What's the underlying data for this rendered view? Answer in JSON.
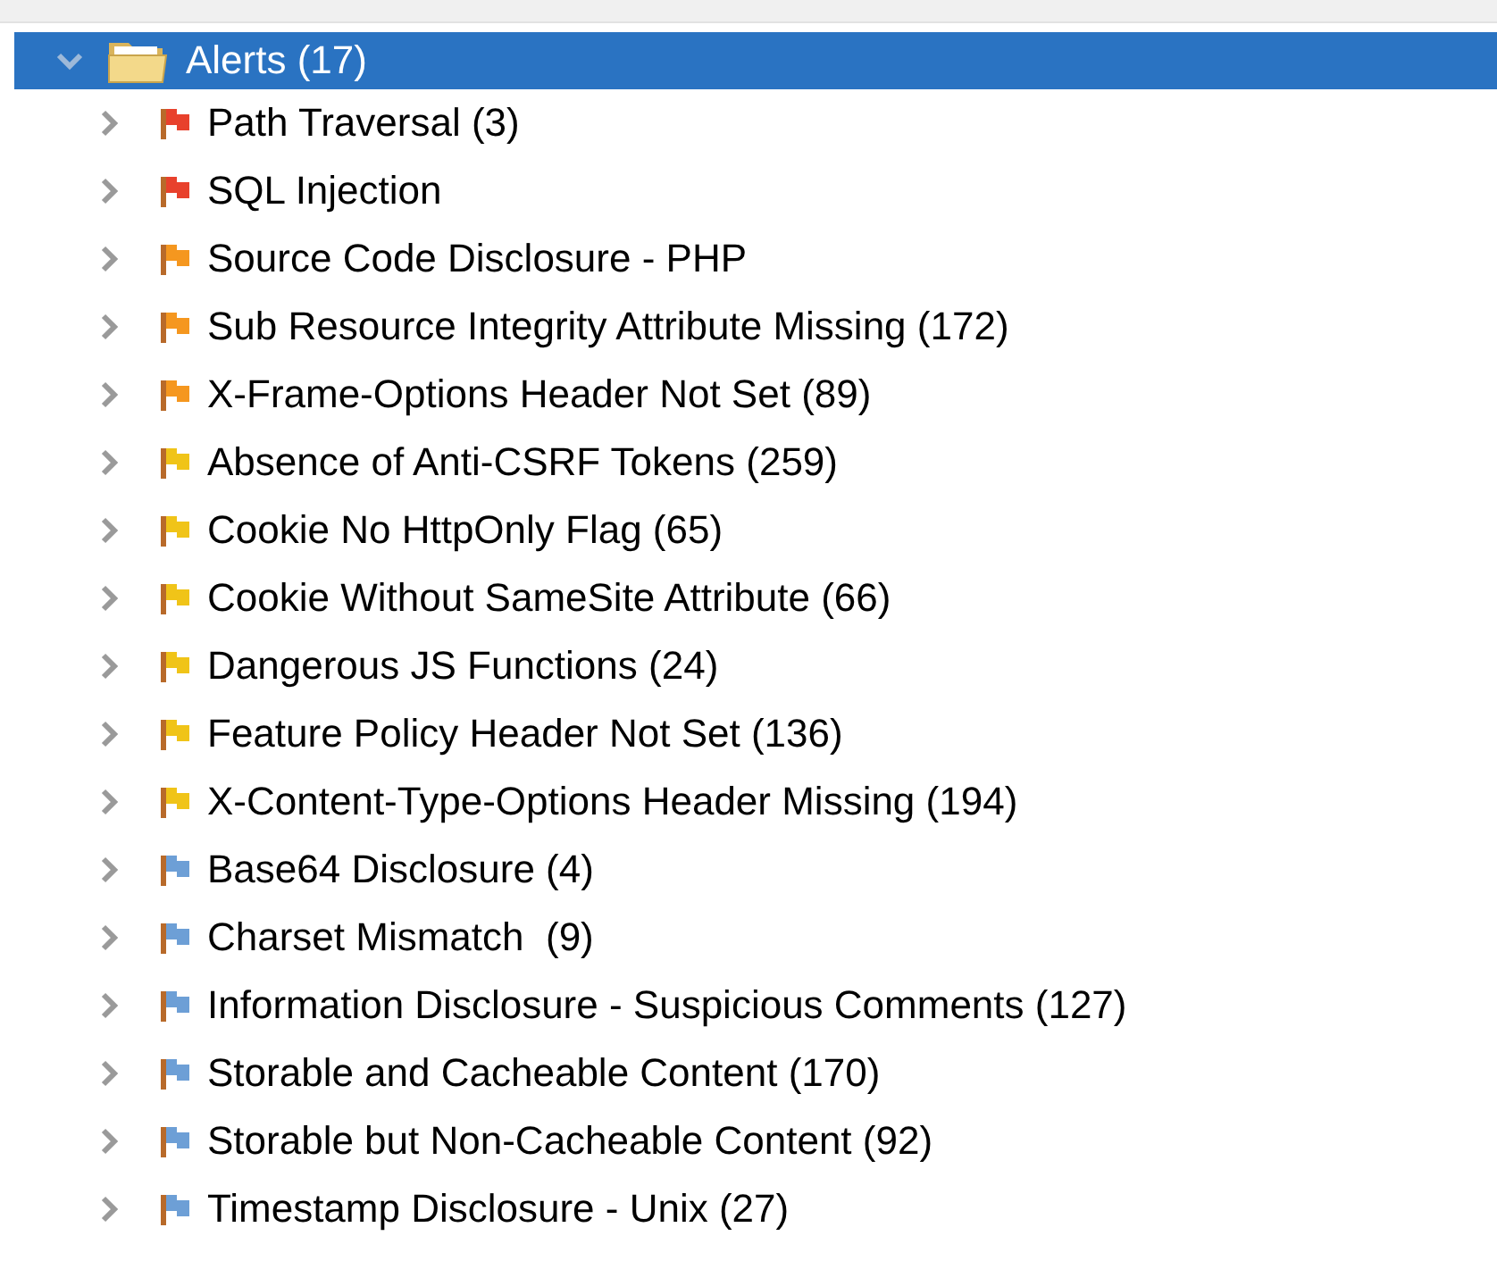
{
  "tree": {
    "label": "Alerts (17)",
    "expanded": true,
    "selected": true,
    "children": [
      {
        "label": "Path Traversal (3)",
        "color": "#e8412c",
        "expanded": false
      },
      {
        "label": "SQL Injection",
        "color": "#e8412c",
        "expanded": false
      },
      {
        "label": "Source Code Disclosure - PHP",
        "color": "#f5971f",
        "expanded": false
      },
      {
        "label": "Sub Resource Integrity Attribute Missing (172)",
        "color": "#f5971f",
        "expanded": false
      },
      {
        "label": "X-Frame-Options Header Not Set (89)",
        "color": "#f5971f",
        "expanded": false
      },
      {
        "label": "Absence of Anti-CSRF Tokens (259)",
        "color": "#f0c418",
        "expanded": false
      },
      {
        "label": "Cookie No HttpOnly Flag (65)",
        "color": "#f0c418",
        "expanded": false
      },
      {
        "label": "Cookie Without SameSite Attribute (66)",
        "color": "#f0c418",
        "expanded": false
      },
      {
        "label": "Dangerous JS Functions (24)",
        "color": "#f0c418",
        "expanded": false
      },
      {
        "label": "Feature Policy Header Not Set (136)",
        "color": "#f0c418",
        "expanded": false
      },
      {
        "label": "X-Content-Type-Options Header Missing (194)",
        "color": "#f0c418",
        "expanded": false
      },
      {
        "label": "Base64 Disclosure (4)",
        "color": "#6d9fd6",
        "expanded": false
      },
      {
        "label": "Charset Mismatch  (9)",
        "color": "#6d9fd6",
        "expanded": false
      },
      {
        "label": "Information Disclosure - Suspicious Comments (127)",
        "color": "#6d9fd6",
        "expanded": false
      },
      {
        "label": "Storable and Cacheable Content (170)",
        "color": "#6d9fd6",
        "expanded": false
      },
      {
        "label": "Storable but Non-Cacheable Content (92)",
        "color": "#6d9fd6",
        "expanded": false
      },
      {
        "label": "Timestamp Disclosure - Unix (27)",
        "color": "#6d9fd6",
        "expanded": false
      }
    ]
  }
}
